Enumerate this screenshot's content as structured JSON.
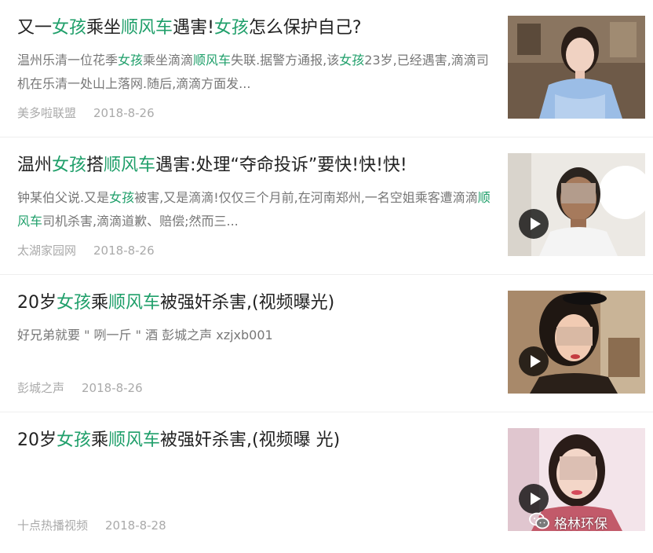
{
  "results": [
    {
      "title": [
        {
          "t": "又一",
          "hl": false
        },
        {
          "t": "女孩",
          "hl": true
        },
        {
          "t": "乘坐",
          "hl": false
        },
        {
          "t": "顺风车",
          "hl": true
        },
        {
          "t": "遇害!",
          "hl": false
        },
        {
          "t": "女孩",
          "hl": true
        },
        {
          "t": "怎么保护自己?",
          "hl": false
        }
      ],
      "snippet": [
        {
          "t": "温州乐清一位花季",
          "hl": false
        },
        {
          "t": "女孩",
          "hl": true
        },
        {
          "t": "乘坐滴滴",
          "hl": false
        },
        {
          "t": "顺风车",
          "hl": true
        },
        {
          "t": "失联.据警方通报,该",
          "hl": false
        },
        {
          "t": "女孩",
          "hl": true
        },
        {
          "t": "23岁,已经遇害,滴滴司机在乐清一处山上落网.随后,滴滴方面发...",
          "hl": false
        }
      ],
      "source": "美多啦联盟",
      "date": "2018-8-26",
      "has_play": false
    },
    {
      "title": [
        {
          "t": "温州",
          "hl": false
        },
        {
          "t": "女孩",
          "hl": true
        },
        {
          "t": "搭",
          "hl": false
        },
        {
          "t": "顺风车",
          "hl": true
        },
        {
          "t": "遇害:处理“夺命投诉”要快!快!快!",
          "hl": false
        }
      ],
      "snippet": [
        {
          "t": "钟某伯父说.又是",
          "hl": false
        },
        {
          "t": "女孩",
          "hl": true
        },
        {
          "t": "被害,又是滴滴!仅仅三个月前,在河南郑州,一名空姐乘客遭滴滴",
          "hl": false
        },
        {
          "t": "顺风车",
          "hl": true
        },
        {
          "t": "司机杀害,滴滴道歉、赔偿;然而三...",
          "hl": false
        }
      ],
      "source": "太湖家园网",
      "date": "2018-8-26",
      "has_play": true
    },
    {
      "title": [
        {
          "t": "20岁",
          "hl": false
        },
        {
          "t": "女孩",
          "hl": true
        },
        {
          "t": "乘",
          "hl": false
        },
        {
          "t": "顺风车",
          "hl": true
        },
        {
          "t": "被强奸杀害,(视频曝光)",
          "hl": false
        }
      ],
      "snippet": [
        {
          "t": "好兄弟就要 \" 咧一斤 \" 酒 彭城之声 xzjxb001",
          "hl": false
        }
      ],
      "source": "彭城之声",
      "date": "2018-8-26",
      "has_play": true
    },
    {
      "title": [
        {
          "t": "20岁",
          "hl": false
        },
        {
          "t": "女孩",
          "hl": true
        },
        {
          "t": "乘",
          "hl": false
        },
        {
          "t": "顺风车",
          "hl": true
        },
        {
          "t": "被强奸杀害,(视频曝 光)",
          "hl": false
        }
      ],
      "snippet": [],
      "source": "十点热播视频",
      "date": "2018-8-28",
      "has_play": true
    }
  ],
  "watermark": {
    "icon": "wechat-icon",
    "text": "格林环保"
  },
  "colors": {
    "highlight": "#1f9f6a",
    "title": "#222222",
    "snippet": "#777777",
    "meta": "#aaaaaa"
  }
}
